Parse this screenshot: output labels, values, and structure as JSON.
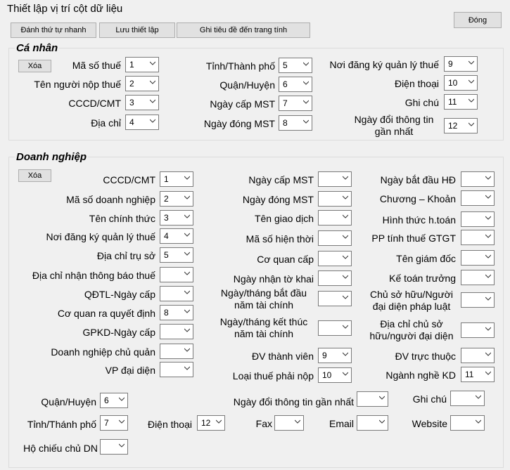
{
  "window_title": "Thiết lập vị trí cột dữ liệu",
  "buttons": {
    "close": "Đóng",
    "quick_number": "Đánh thứ tự nhanh",
    "save": "Lưu thiết lập",
    "write_header": "Ghi tiêu đề đến trang tính"
  },
  "ca_nhan": {
    "title": "Cá nhân",
    "clear": "Xóa",
    "fields": [
      {
        "label": "Mã số thuế",
        "value": "1"
      },
      {
        "label": "Tên người nộp thuế",
        "value": "2"
      },
      {
        "label": "CCCD/CMT",
        "value": "3"
      },
      {
        "label": "Địa chỉ",
        "value": "4"
      },
      {
        "label": "Tỉnh/Thành phố",
        "value": "5"
      },
      {
        "label": "Quận/Huyện",
        "value": "6"
      },
      {
        "label": "Ngày cấp MST",
        "value": "7"
      },
      {
        "label": "Ngày đóng MST",
        "value": "8"
      },
      {
        "label": "Nơi đăng ký quản lý thuế",
        "value": "9"
      },
      {
        "label": "Điện thoại",
        "value": "10"
      },
      {
        "label": "Ghi chú",
        "value": "11"
      },
      {
        "label": "Ngày đổi thông tin",
        "label2": "gần nhất",
        "value": "12"
      }
    ]
  },
  "doanh_nghiep": {
    "title": "Doanh nghiệp",
    "clear": "Xóa",
    "col1": [
      {
        "label": "CCCD/CMT",
        "value": "1"
      },
      {
        "label": "Mã số doanh nghiệp",
        "value": "2"
      },
      {
        "label": "Tên chính thức",
        "value": "3"
      },
      {
        "label": "Nơi đăng ký quản lý thuế",
        "value": "4"
      },
      {
        "label": "Địa chỉ trụ sở",
        "value": "5"
      },
      {
        "label": "Địa chỉ nhận thông báo thuế",
        "value": ""
      },
      {
        "label": "QĐTL-Ngày cấp",
        "value": ""
      },
      {
        "label": "Cơ quan ra quyết định",
        "value": "8"
      },
      {
        "label": "GPKD-Ngày cấp",
        "value": ""
      },
      {
        "label": "Doanh nghiệp chủ quản",
        "value": ""
      },
      {
        "label": "VP đại diện",
        "value": ""
      }
    ],
    "col2": [
      {
        "label": "Ngày cấp MST",
        "value": ""
      },
      {
        "label": "Ngày đóng MST",
        "value": ""
      },
      {
        "label": "Tên giao dịch",
        "value": ""
      },
      {
        "label": "Mã số hiện thời",
        "value": ""
      },
      {
        "label": "Cơ quan cấp",
        "value": ""
      },
      {
        "label": "Ngày nhận tờ khai",
        "value": ""
      },
      {
        "label": "Ngày/tháng bắt đầu",
        "label2": "năm tài chính",
        "value": ""
      },
      {
        "label": "Ngày/tháng kết thúc",
        "label2": "năm tài chính",
        "value": ""
      },
      {
        "label": "ĐV thành viên",
        "value": "9"
      },
      {
        "label": "Loại thuế phải nộp",
        "value": "10"
      }
    ],
    "col3": [
      {
        "label": "Ngày bắt đầu HĐ",
        "value": ""
      },
      {
        "label": "Chương – Khoản",
        "value": ""
      },
      {
        "label": "Hình thức h.toán",
        "value": ""
      },
      {
        "label": "PP tính thuế GTGT",
        "value": ""
      },
      {
        "label": "Tên giám đốc",
        "value": ""
      },
      {
        "label": "Kế toán trưởng",
        "value": ""
      },
      {
        "label": "Chủ sở hữu/Người",
        "label2": "đại diện pháp luật",
        "value": ""
      },
      {
        "label": "Địa chỉ chủ sở",
        "label2": "hữu/người đại diện",
        "value": ""
      },
      {
        "label": "ĐV trực thuộc",
        "value": ""
      },
      {
        "label": "Ngành nghề KD",
        "value": "11"
      }
    ],
    "bottom": [
      {
        "label": "Quận/Huyện",
        "value": "6"
      },
      {
        "label": "Tỉnh/Thánh phố",
        "value": "7"
      },
      {
        "label": "Hộ chiếu chủ DN",
        "value": ""
      },
      {
        "label": "Ngày đổi thông tin gần nhất",
        "value": ""
      },
      {
        "label": "Điện thoại",
        "value": "12"
      },
      {
        "label": "Fax",
        "value": ""
      },
      {
        "label": "Ghi chú",
        "value": ""
      },
      {
        "label": "Email",
        "value": ""
      },
      {
        "label": "Website",
        "value": ""
      }
    ]
  }
}
